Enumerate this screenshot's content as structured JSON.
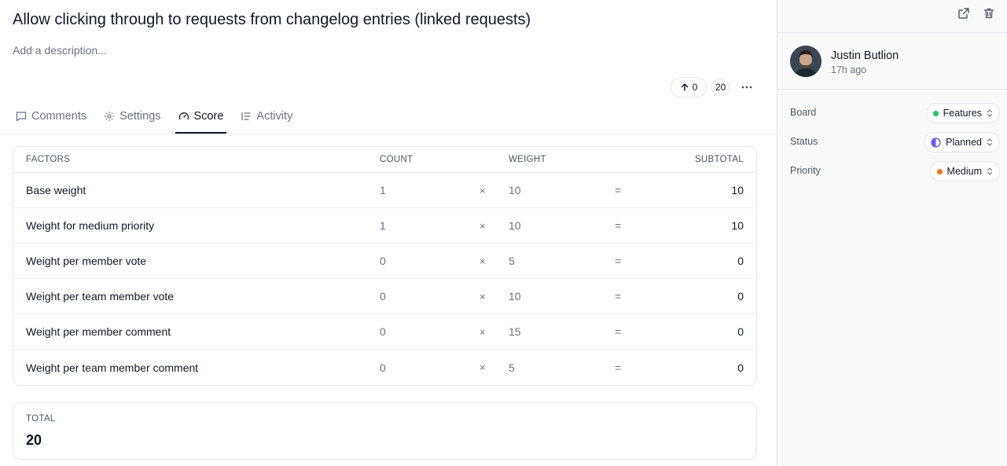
{
  "post": {
    "title": "Allow clicking through to requests from changelog entries (linked requests)",
    "description_placeholder": "Add a description..."
  },
  "actions": {
    "upvote_count": "0",
    "score": "20",
    "more_icon": "more-horizontal-icon"
  },
  "tabs": [
    {
      "label": "Comments",
      "icon": "comment-icon"
    },
    {
      "label": "Settings",
      "icon": "gear-icon"
    },
    {
      "label": "Score",
      "icon": "gauge-icon",
      "active": true
    },
    {
      "label": "Activity",
      "icon": "activity-list-icon"
    }
  ],
  "score_table": {
    "headers": {
      "factors": "FACTORS",
      "count": "COUNT",
      "weight": "WEIGHT",
      "subtotal": "SUBTOTAL"
    },
    "times_symbol": "×",
    "equals_symbol": "=",
    "rows": [
      {
        "factor": "Base weight",
        "count": "1",
        "weight": "10",
        "subtotal": "10"
      },
      {
        "factor": "Weight for medium priority",
        "count": "1",
        "weight": "10",
        "subtotal": "10"
      },
      {
        "factor": "Weight per member vote",
        "count": "0",
        "weight": "5",
        "subtotal": "0"
      },
      {
        "factor": "Weight per team member vote",
        "count": "0",
        "weight": "10",
        "subtotal": "0"
      },
      {
        "factor": "Weight per member comment",
        "count": "0",
        "weight": "15",
        "subtotal": "0"
      },
      {
        "factor": "Weight per team member comment",
        "count": "0",
        "weight": "5",
        "subtotal": "0"
      }
    ]
  },
  "total": {
    "label": "TOTAL",
    "value": "20"
  },
  "sidebar": {
    "author": {
      "name": "Justin Butlion",
      "time": "17h ago"
    },
    "properties": [
      {
        "label": "Board",
        "value": "Features",
        "indicator_color": "#22c55e",
        "indicator": "dot"
      },
      {
        "label": "Status",
        "value": "Planned",
        "indicator_color": "#6d5ce7",
        "indicator": "half-circle"
      },
      {
        "label": "Priority",
        "value": "Medium",
        "indicator_color": "#f97316",
        "indicator": "dot"
      }
    ]
  },
  "colors": {
    "accent": "#111827",
    "border": "#e5e7eb",
    "muted": "#6b7280"
  }
}
